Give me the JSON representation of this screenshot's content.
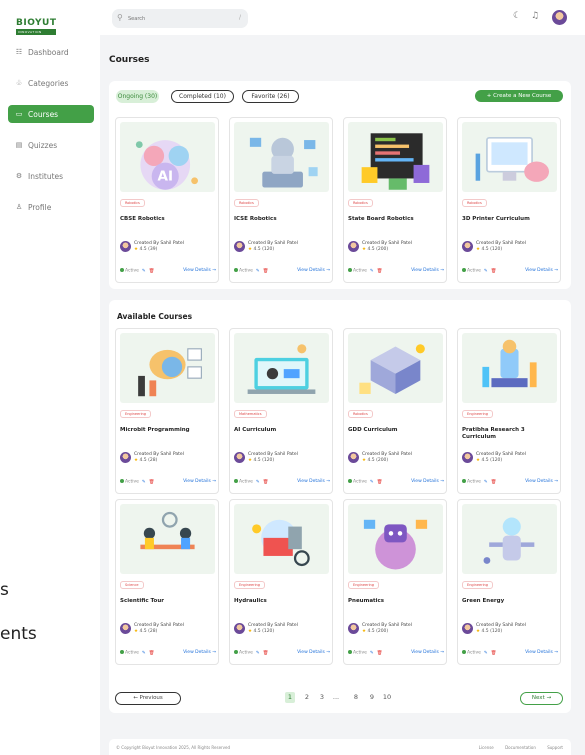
{
  "sidebar": {
    "logo": {
      "main": "BIOYUT",
      "sub": "INNOVATION"
    },
    "items": [
      {
        "icon": "dashboard-icon",
        "glyph": "☷",
        "label": "Dashboard"
      },
      {
        "icon": "categories-icon",
        "glyph": "♧",
        "label": "Categories"
      },
      {
        "icon": "courses-icon",
        "glyph": "▭",
        "label": "Courses"
      },
      {
        "icon": "quizzes-icon",
        "glyph": "▤",
        "label": "Quizzes"
      },
      {
        "icon": "institutes-icon",
        "glyph": "⚙",
        "label": "Institutes"
      },
      {
        "icon": "profile-icon",
        "glyph": "♙",
        "label": "Profile"
      }
    ],
    "active_index": 2
  },
  "overflow_text": [
    "s",
    "ents"
  ],
  "topbar": {
    "search_placeholder": "Search",
    "search_shortcut": "/",
    "icons": [
      "theme-toggle-icon",
      "notification-bell-icon",
      "user-avatar"
    ]
  },
  "page_title": "Courses",
  "tabs": [
    {
      "label": "Ongoing (30)",
      "active": true
    },
    {
      "label": "Completed (10)",
      "active": false
    },
    {
      "label": "Favorite (26)",
      "active": false
    }
  ],
  "create_button": "+  Create a New Course",
  "ongoing_cards": [
    {
      "category": "Robotics",
      "title": "CBSE Robotics",
      "creator": "Created By Sahil Patel",
      "rating": "4.5 (39)",
      "art": "ai"
    },
    {
      "category": "Robotics",
      "title": "ICSE Robotics",
      "creator": "Created By Sahil Patel",
      "rating": "4.5 (120)",
      "art": "robot"
    },
    {
      "category": "Robotics",
      "title": "State Board Robotics",
      "creator": "Created By Sahil Patel",
      "rating": "4.5 (200)",
      "art": "code"
    },
    {
      "category": "Robotics",
      "title": "3D Printer Curriculum",
      "creator": "Created By Sahil Patel",
      "rating": "4.5 (120)",
      "art": "printer"
    }
  ],
  "available_title": "Available Courses",
  "available_cards": [
    {
      "category": "Engineering",
      "title": "Microbit Programming",
      "creator": "Created By Sahil Patel",
      "rating": "4.5 (28)",
      "art": "brain"
    },
    {
      "category": "Mathematics",
      "title": "AI Curriculum",
      "creator": "Created By Sahil Patel",
      "rating": "4.5 (120)",
      "art": "laptop"
    },
    {
      "category": "Robotics",
      "title": "GDD Curriculum",
      "creator": "Created By Sahil Patel",
      "rating": "4.5 (200)",
      "art": "iso"
    },
    {
      "category": "Engineering",
      "title": "Pratibha Research 3 Curriculum",
      "creator": "Created By Sahil Patel",
      "rating": "4.5 (120)",
      "art": "research"
    },
    {
      "category": "Science",
      "title": "Scientific Tour",
      "creator": "Created By Sahil Patel",
      "rating": "4.5 (28)",
      "art": "team"
    },
    {
      "category": "Engineering",
      "title": "Hydraulics",
      "creator": "Created By Sahil Patel",
      "rating": "4.5 (120)",
      "art": "tools"
    },
    {
      "category": "Engineering",
      "title": "Pneumatics",
      "creator": "Created By Sahil Patel",
      "rating": "4.5 (200)",
      "art": "bot"
    },
    {
      "category": "Engineering",
      "title": "Green Energy",
      "creator": "Created By Sahil Patel",
      "rating": "4.5 (120)",
      "art": "human"
    }
  ],
  "card_footer": {
    "status": "Active",
    "view": "View Details →"
  },
  "pagination": {
    "prev": "← Previous",
    "next": "Next →",
    "pages": [
      "1",
      "2",
      "3",
      "...",
      "8",
      "9",
      "10"
    ],
    "active": "1"
  },
  "footer": {
    "copyright": "© Copyright Bioyut Innovation 2025, All Rights Reserved",
    "links": [
      "License",
      "Documentation",
      "Support"
    ]
  },
  "colors": {
    "accent": "#43a047",
    "tag_red": "#d44444",
    "link_blue": "#1e6fd9"
  }
}
